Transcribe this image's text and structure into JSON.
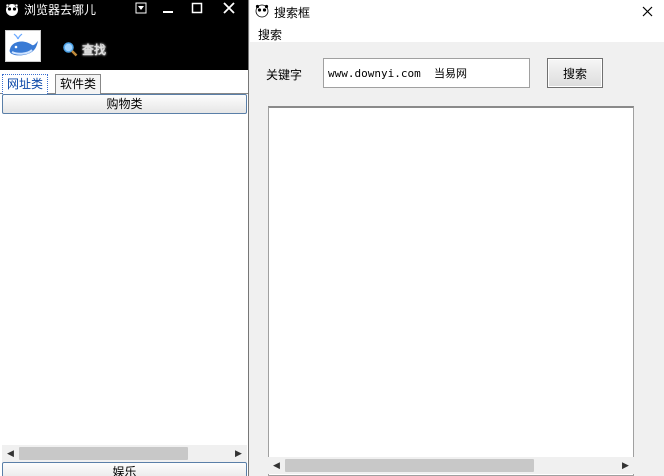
{
  "left_window": {
    "title": "浏览器去哪儿",
    "search_link": "查找",
    "tabs": [
      {
        "label": "网址类",
        "active": true
      },
      {
        "label": "软件类",
        "active": false
      }
    ],
    "category_button": "购物类",
    "bottom_category": "娱乐",
    "scroll_fraction": 0.8
  },
  "right_window": {
    "title": "搜索框",
    "menu": [
      "搜索"
    ],
    "keyword_label": "关键字",
    "keyword_value": "www.downyi.com  当易网",
    "search_button": "搜索",
    "scroll_fraction": 0.75
  },
  "icons": {
    "app_icon": "panda-icon",
    "logo": "whale-icon",
    "search": "magnifier-icon"
  }
}
